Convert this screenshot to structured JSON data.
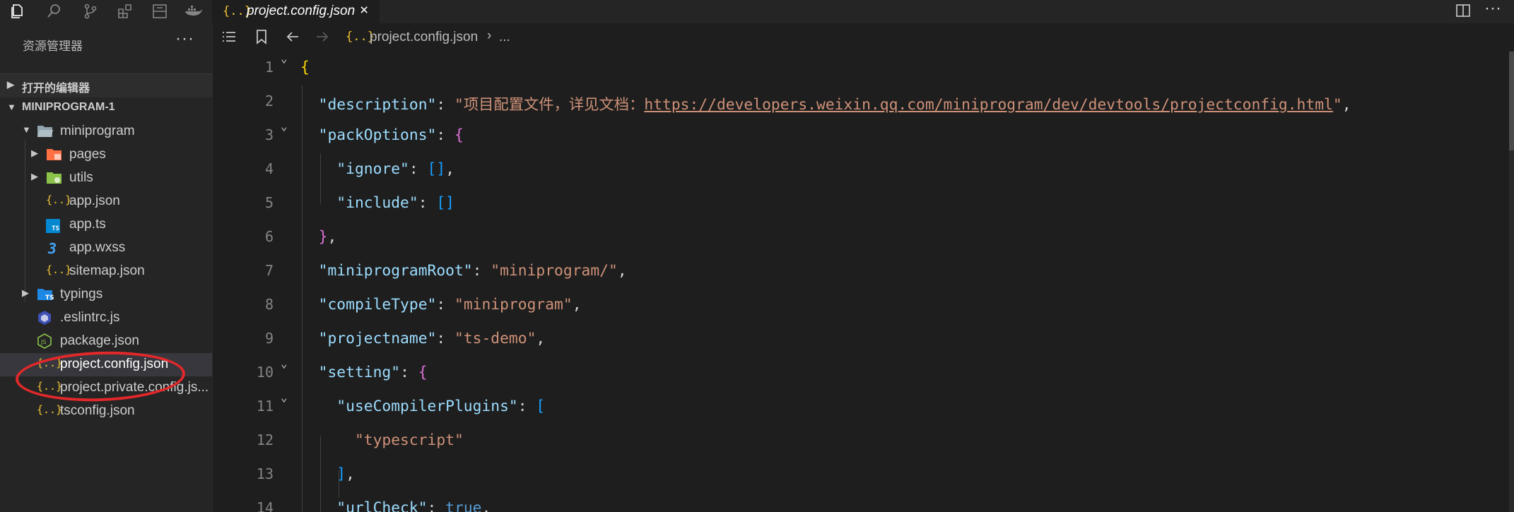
{
  "activity_icons": [
    "files-icon",
    "search-icon",
    "source-control-icon",
    "extensions-icon",
    "remote-explorer-icon",
    "docker-icon"
  ],
  "sidebar": {
    "title": "资源管理器",
    "more": "···",
    "sections": {
      "open_editors": "打开的编辑器",
      "project": "MINIPROGRAM-1"
    },
    "tree": [
      {
        "label": "miniprogram",
        "icon": "folder-open-icon"
      },
      {
        "label": "pages",
        "icon": "folder-pages-icon"
      },
      {
        "label": "utils",
        "icon": "folder-utils-icon"
      },
      {
        "label": "app.json",
        "icon": "json-icon",
        "glyph": "{..}"
      },
      {
        "label": "app.ts",
        "icon": "typescript-icon",
        "glyph": "TS"
      },
      {
        "label": "app.wxss",
        "icon": "css-icon",
        "glyph": "3"
      },
      {
        "label": "sitemap.json",
        "icon": "json-icon",
        "glyph": "{..}"
      },
      {
        "label": "typings",
        "icon": "folder-typings-icon",
        "glyph": "TS"
      },
      {
        "label": ".eslintrc.js",
        "icon": "eslint-icon"
      },
      {
        "label": "package.json",
        "icon": "nodejs-icon",
        "glyph": "JS"
      },
      {
        "label": "project.config.json",
        "icon": "json-icon",
        "glyph": "{..}"
      },
      {
        "label": "project.private.config.js...",
        "icon": "json-icon",
        "glyph": "{..}"
      },
      {
        "label": "tsconfig.json",
        "icon": "json-icon",
        "glyph": "{..}"
      }
    ]
  },
  "tab": {
    "glyph": "{..}",
    "label": "project.config.json",
    "close": "×"
  },
  "breadcrumb": {
    "glyph": "{..}",
    "file": "project.config.json",
    "separator": "›",
    "ellipsis": "..."
  },
  "editor": {
    "line_numbers": [
      "1",
      "2",
      "3",
      "4",
      "5",
      "6",
      "7",
      "8",
      "9",
      "10",
      "11",
      "12",
      "13",
      "14"
    ],
    "code": {
      "l1_brace": "{",
      "l2_key": "\"description\"",
      "l2_colon": ": ",
      "l2_open": "\"项目配置文件，详见文档：",
      "l2_url": "https://developers.weixin.qq.com/miniprogram/dev/devtools/projectconfig.html",
      "l2_close": "\"",
      "l2_comma": ",",
      "l3_key": "\"packOptions\"",
      "l3_colon": ": ",
      "l3_brace": "{",
      "l4_key": "\"ignore\"",
      "l4_colon": ": ",
      "l4_arr": "[]",
      "l4_comma": ",",
      "l5_key": "\"include\"",
      "l5_colon": ": ",
      "l5_arr": "[]",
      "l6_brace": "}",
      "l6_comma": ",",
      "l7_key": "\"miniprogramRoot\"",
      "l7_colon": ": ",
      "l7_val": "\"miniprogram/\"",
      "l7_comma": ",",
      "l8_key": "\"compileType\"",
      "l8_colon": ": ",
      "l8_val": "\"miniprogram\"",
      "l8_comma": ",",
      "l9_key": "\"projectname\"",
      "l9_colon": ": ",
      "l9_val": "\"ts-demo\"",
      "l9_comma": ",",
      "l10_key": "\"setting\"",
      "l10_colon": ": ",
      "l10_brace": "{",
      "l11_key": "\"useCompilerPlugins\"",
      "l11_colon": ": ",
      "l11_bracket": "[",
      "l12_val": "\"typescript\"",
      "l13_bracket": "]",
      "l13_comma": ",",
      "l14_key": "\"urlCheck\"",
      "l14_colon": ": ",
      "l14_val": "true",
      "l14_comma": ","
    }
  },
  "colors": {
    "background": "#1e1e1e",
    "sidebar": "#252526",
    "json_key": "#9cdcfe",
    "json_string": "#ce9178",
    "bracket_gold": "#ffd700",
    "bracket_purple": "#da70d6",
    "bracket_blue": "#179fff",
    "annotation_red": "#e2282a"
  }
}
